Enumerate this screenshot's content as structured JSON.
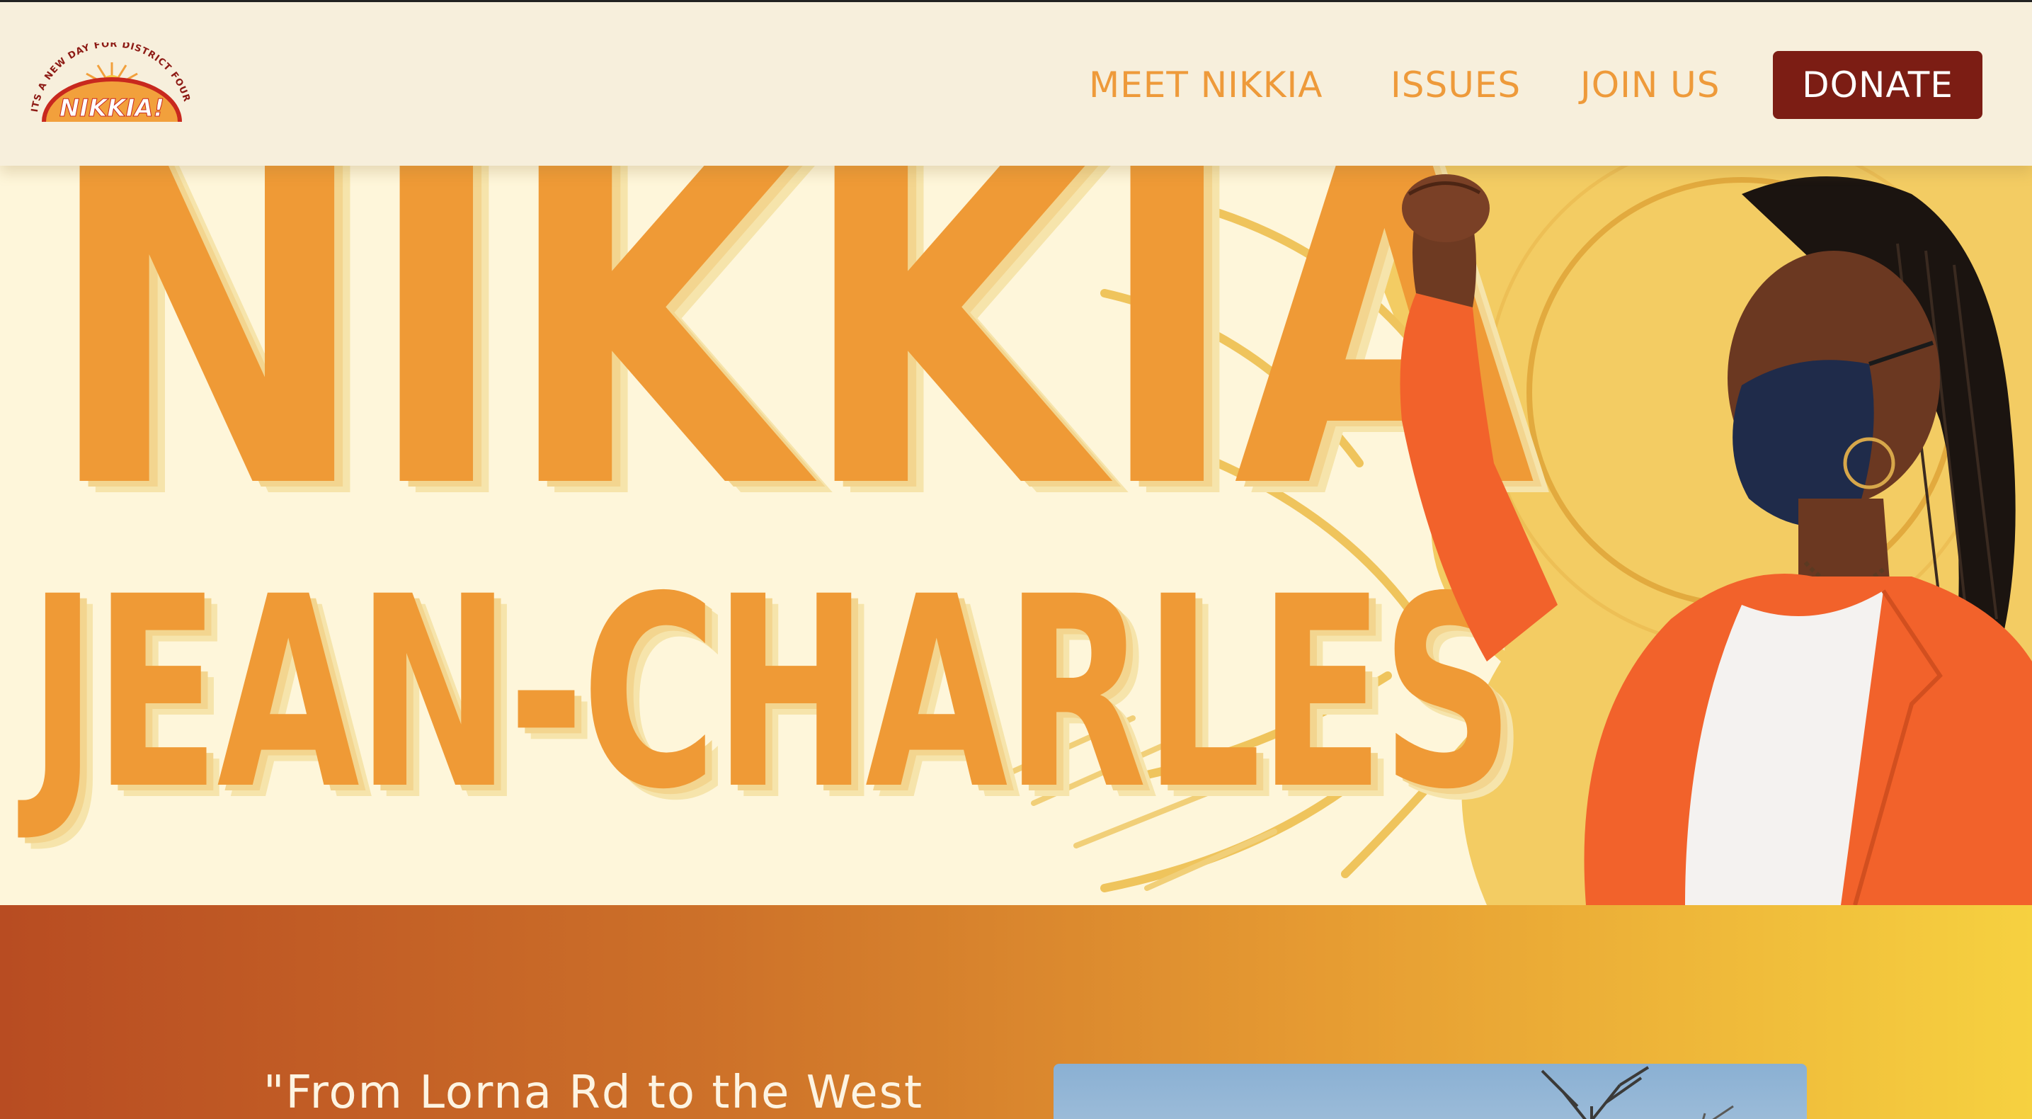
{
  "header": {
    "logo": {
      "arc_text": "ITS A NEW DAY FOR DISTRICT FOUR",
      "wordmark": "NIKKIA!",
      "sun_color": "#f2a03c",
      "arc_color": "#c8281e"
    },
    "nav": [
      {
        "label": "MEET NIKKIA"
      },
      {
        "label": "ISSUES"
      },
      {
        "label": "JOIN US"
      }
    ],
    "donate_label": "DONATE",
    "colors": {
      "nav": "#ee9a3a",
      "donate_bg": "#7c1d14",
      "header_bg": "#f7efdc"
    }
  },
  "hero": {
    "first_name": "NIKKIA",
    "last_name": "JEAN-CHARLES",
    "portrait_icon": "campaign-portrait-raised-fist",
    "colors": {
      "name": "#ef9a36",
      "shadow": "#f3d58f",
      "background": "#fef6da"
    }
  },
  "band": {
    "quote": "\"From Lorna Rd to the West",
    "gradient": [
      "#b84c22",
      "#cd7129",
      "#e69b32",
      "#f6d140"
    ],
    "photo_icon": "bare-tree-sky-photo"
  }
}
